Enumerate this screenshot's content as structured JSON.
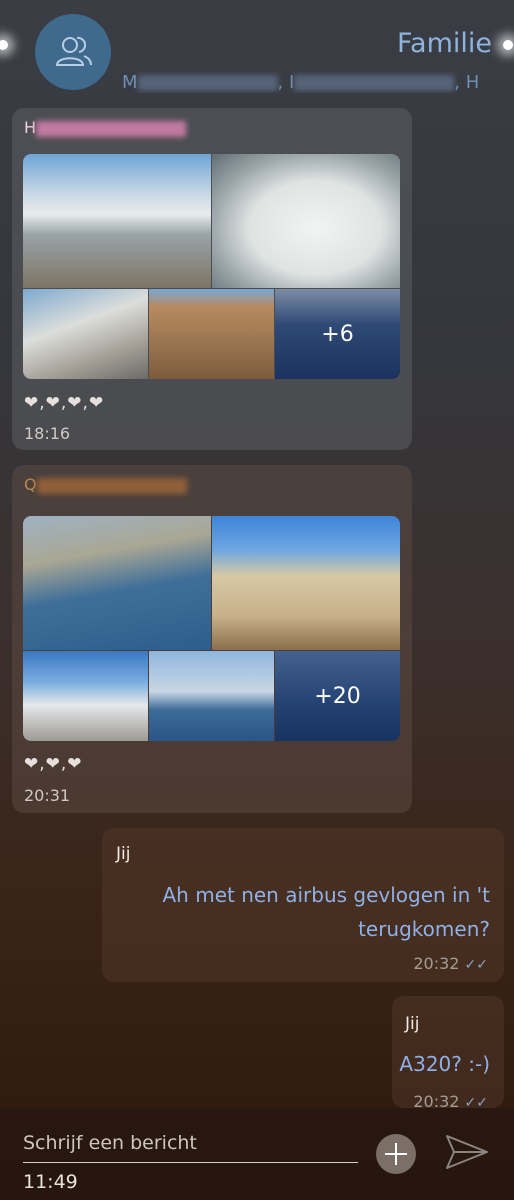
{
  "header": {
    "title": "Familie",
    "members_start": "M",
    "members_sep1": ", ",
    "members_mid": "I",
    "members_sep2": ", ",
    "members_end": "H",
    "avatar_icon": "group-icon"
  },
  "messages": [
    {
      "sender_initial": "H",
      "more_count": "+6",
      "reactions": "❤,❤,❤,❤",
      "time": "18:16"
    },
    {
      "sender_initial": "Q",
      "more_count": "+20",
      "reactions": "❤,❤,❤",
      "time": "20:31"
    },
    {
      "sender": "Jij",
      "text_line1": "Ah met nen airbus gevlogen in 't",
      "text_line2": "terugkomen?",
      "time": "20:32",
      "status": "✓✓"
    },
    {
      "sender": "Jij",
      "text": "A320? :-)",
      "time": "20:32",
      "status": "✓✓"
    }
  ],
  "composer": {
    "placeholder": "Schrijf een bericht",
    "clock": "11:49",
    "attach_icon": "plus-icon",
    "send_icon": "send-icon"
  },
  "colors": {
    "accent": "#8fb3df",
    "avatar_bg": "#3f6a8e",
    "outgoing_text": "#8fb0e6"
  }
}
